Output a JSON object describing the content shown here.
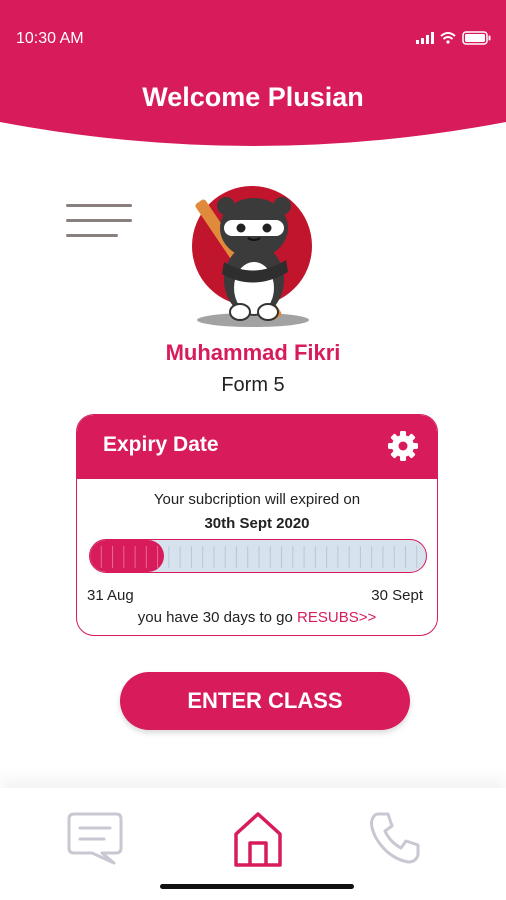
{
  "status": {
    "time": "10:30 AM"
  },
  "header": {
    "title": "Welcome Plusian"
  },
  "user": {
    "name": "Muhammad Fikri",
    "form": "Form 5"
  },
  "subscription": {
    "card_title": "Expiry Date",
    "message": "Your subcription will expired on",
    "expiry_date": "30th Sept 2020",
    "start_label": "31 Aug",
    "end_label": "30 Sept",
    "days_left_text": "you have 30 days to go",
    "resubs_link": "RESUBS>>",
    "progress_fraction": 0.22
  },
  "actions": {
    "enter_class": "ENTER CLASS"
  },
  "nav": {
    "items": [
      "chat-icon",
      "home-icon",
      "phone-icon"
    ],
    "active": "home-icon"
  },
  "colors": {
    "accent": "#d81b5b",
    "progress_track": "#d6e2ee",
    "inactive_icon": "#c8c8d2"
  }
}
